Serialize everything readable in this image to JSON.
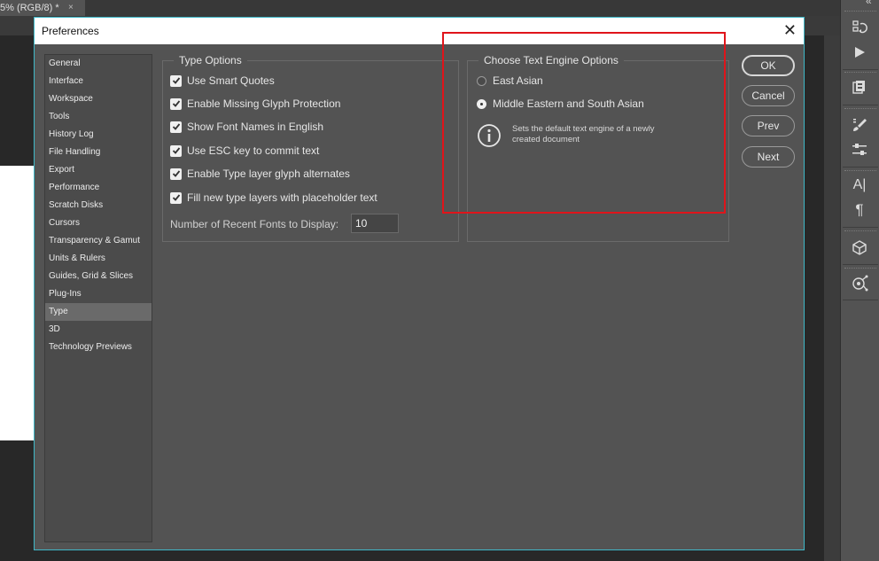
{
  "document_tab": {
    "label": "5% (RGB/8) *",
    "close": "×"
  },
  "dialog": {
    "title": "Preferences",
    "close_glyph": "✕",
    "nav_items": [
      "General",
      "Interface",
      "Workspace",
      "Tools",
      "History Log",
      "File Handling",
      "Export",
      "Performance",
      "Scratch Disks",
      "Cursors",
      "Transparency & Gamut",
      "Units & Rulers",
      "Guides, Grid & Slices",
      "Plug-Ins",
      "Type",
      "3D",
      "Technology Previews"
    ],
    "active_nav": "Type",
    "type_options": {
      "title": "Type Options",
      "checkboxes": [
        {
          "label": "Use Smart Quotes",
          "checked": true
        },
        {
          "label": "Enable Missing Glyph Protection",
          "checked": true
        },
        {
          "label": "Show Font Names in English",
          "checked": true
        },
        {
          "label": "Use ESC key to commit text",
          "checked": true
        },
        {
          "label": "Enable Type layer glyph alternates",
          "checked": true
        },
        {
          "label": "Fill new type layers with placeholder text",
          "checked": true
        }
      ],
      "recent_fonts_label": "Number of Recent Fonts to Display:",
      "recent_fonts_value": "10"
    },
    "text_engine": {
      "title": "Choose Text Engine Options",
      "options": [
        {
          "label": "East Asian",
          "selected": false
        },
        {
          "label": "Middle Eastern and South Asian",
          "selected": true
        }
      ],
      "info_icon": "info-icon",
      "info_text_line1": "Sets the default text engine of a newly",
      "info_text_line2": "created document"
    },
    "buttons": {
      "ok": "OK",
      "cancel": "Cancel",
      "prev": "Prev",
      "next": "Next"
    }
  },
  "right_panel": {
    "collapse_glyph": "«",
    "icons": [
      "history-icon",
      "play-actions-icon",
      "layer-comps-icon",
      "brush-icon",
      "adjustments-icon",
      "character-icon",
      "paragraph-icon",
      "3d-cube-icon",
      "properties-icon"
    ],
    "character_glyph": "A|",
    "paragraph_glyph": "¶"
  },
  "colors": {
    "highlight": "#e0141a",
    "dialog_border": "#3fb8c8",
    "panel_bg": "#535353"
  }
}
